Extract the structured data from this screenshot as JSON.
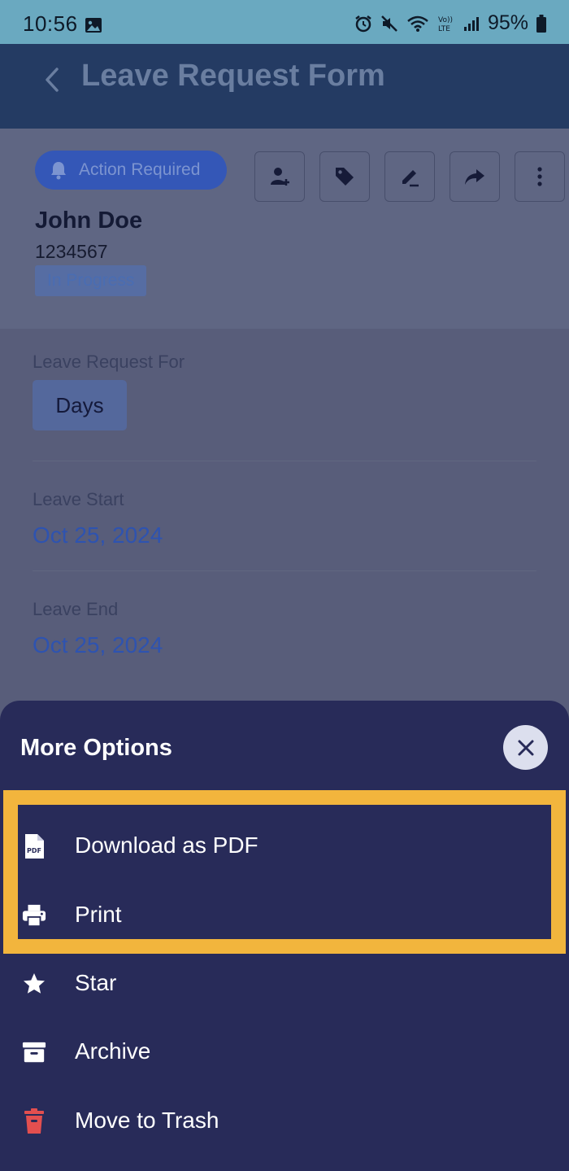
{
  "status_bar": {
    "time": "10:56",
    "battery": "95%"
  },
  "app_bar": {
    "title": "Leave Request Form"
  },
  "header": {
    "action_badge": "Action Required",
    "name": "John Doe",
    "id": "1234567",
    "status": "In Progress"
  },
  "fields": {
    "leave_for_label": "Leave Request For",
    "leave_for_value": "Days",
    "leave_start_label": "Leave Start",
    "leave_start_value": "Oct 25, 2024",
    "leave_end_label": "Leave End",
    "leave_end_value": "Oct 25, 2024"
  },
  "sheet": {
    "title": "More Options",
    "options": [
      {
        "label": "Download as PDF",
        "icon": "pdf-file-icon"
      },
      {
        "label": "Print",
        "icon": "printer-icon"
      },
      {
        "label": "Star",
        "icon": "star-icon"
      },
      {
        "label": "Archive",
        "icon": "archive-icon"
      },
      {
        "label": "Move to Trash",
        "icon": "trash-icon"
      }
    ]
  },
  "colors": {
    "highlight": "#f2b53d",
    "sheet_bg": "#282b59",
    "trash_red": "#e34f4f"
  }
}
